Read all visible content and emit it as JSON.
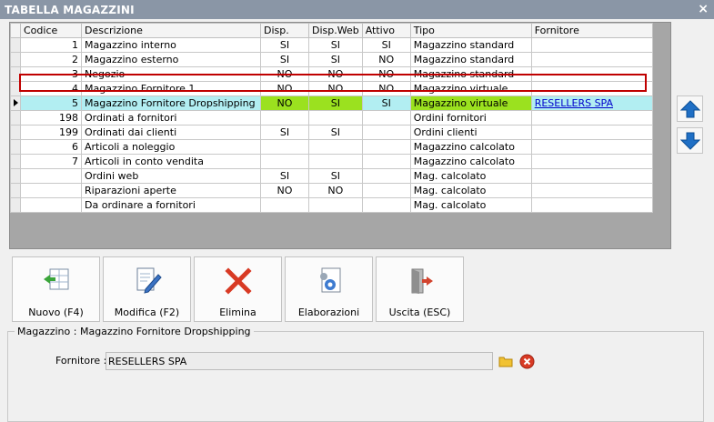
{
  "window": {
    "title": "TABELLA MAGAZZINI",
    "close_label": "×"
  },
  "grid": {
    "columns": [
      "Codice",
      "Descrizione",
      "Disp.",
      "Disp.Web",
      "Attivo",
      "Tipo",
      "Fornitore"
    ],
    "rows": [
      {
        "codice": "1",
        "descrizione": "Magazzino interno",
        "disp": "SI",
        "dispweb": "SI",
        "attivo": "SI",
        "tipo": "Magazzino standard",
        "fornitore": ""
      },
      {
        "codice": "2",
        "descrizione": "Magazzino esterno",
        "disp": "SI",
        "dispweb": "SI",
        "attivo": "NO",
        "tipo": "Magazzino standard",
        "fornitore": ""
      },
      {
        "codice": "3",
        "descrizione": "Negozio",
        "disp": "NO",
        "dispweb": "NO",
        "attivo": "NO",
        "tipo": "Magazzino standard",
        "fornitore": ""
      },
      {
        "codice": "4",
        "descrizione": "Magazzino Fornitore 1",
        "disp": "NO",
        "dispweb": "NO",
        "attivo": "NO",
        "tipo": "Magazzino virtuale",
        "fornitore": ""
      },
      {
        "codice": "5",
        "descrizione": "Magazzino Fornitore Dropshipping",
        "disp": "NO",
        "dispweb": "SI",
        "attivo": "SI",
        "tipo": "Magazzino virtuale",
        "fornitore": "RESELLERS SPA",
        "selected": true
      },
      {
        "codice": "198",
        "descrizione": "Ordinati a fornitori",
        "disp": "",
        "dispweb": "",
        "attivo": "",
        "tipo": "Ordini fornitori",
        "fornitore": ""
      },
      {
        "codice": "199",
        "descrizione": "Ordinati dai clienti",
        "disp": "SI",
        "dispweb": "SI",
        "attivo": "",
        "tipo": "Ordini clienti",
        "fornitore": ""
      },
      {
        "codice": "6",
        "descrizione": "Articoli a noleggio",
        "disp": "",
        "dispweb": "",
        "attivo": "",
        "tipo": "Magazzino calcolato",
        "fornitore": ""
      },
      {
        "codice": "7",
        "descrizione": "Articoli in conto vendita",
        "disp": "",
        "dispweb": "",
        "attivo": "",
        "tipo": "Magazzino calcolato",
        "fornitore": ""
      },
      {
        "codice": "",
        "descrizione": "Ordini web",
        "disp": "SI",
        "dispweb": "SI",
        "attivo": "",
        "tipo": "Mag. calcolato",
        "fornitore": ""
      },
      {
        "codice": "",
        "descrizione": "Riparazioni aperte",
        "disp": "NO",
        "dispweb": "NO",
        "attivo": "",
        "tipo": "Mag. calcolato",
        "fornitore": ""
      },
      {
        "codice": "",
        "descrizione": "Da ordinare a fornitori",
        "disp": "",
        "dispweb": "",
        "attivo": "",
        "tipo": "Mag. calcolato",
        "fornitore": ""
      }
    ]
  },
  "side_buttons": {
    "up_icon": "arrow-up-icon",
    "down_icon": "arrow-down-icon"
  },
  "toolbar": {
    "new_label": "Nuovo (F4)",
    "edit_label": "Modifica (F2)",
    "delete_label": "Elimina",
    "process_label": "Elaborazioni",
    "exit_label": "Uscita (ESC)"
  },
  "detail": {
    "group_title": "Magazzino : Magazzino Fornitore Dropshipping",
    "supplier_label": "Fornitore :",
    "supplier_value": "RESELLERS SPA"
  },
  "colors": {
    "selected_row": "#b2eef2",
    "highlight_green": "#9be11f",
    "selection_border": "#c00000",
    "title_bar": "#8a96a6"
  }
}
